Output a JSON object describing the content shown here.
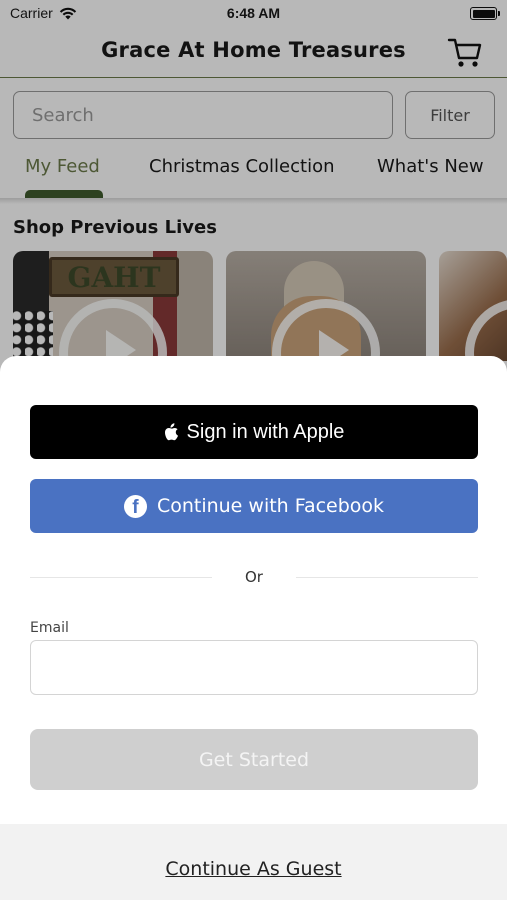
{
  "status_bar": {
    "carrier": "Carrier",
    "time": "6:48 AM"
  },
  "header": {
    "title": "Grace At Home Treasures",
    "cart_icon": "cart-icon"
  },
  "search": {
    "placeholder": "Search",
    "value": "",
    "filter_label": "Filter"
  },
  "tabs": [
    {
      "label": "My Feed",
      "active": true
    },
    {
      "label": "Christmas Collection",
      "active": false
    },
    {
      "label": "What's New",
      "active": false
    }
  ],
  "section": {
    "title": "Shop Previous Lives",
    "thumbnails": [
      {
        "sign_text": "GAHT"
      },
      {
        "sign_text": ""
      },
      {
        "sign_text": ""
      }
    ]
  },
  "sheet": {
    "apple_label": "Sign in with Apple",
    "facebook_label": "Continue with Facebook",
    "or_text": "Or",
    "email_label": "Email",
    "email_value": "",
    "get_started_label": "Get Started",
    "guest_label": "Continue As Guest"
  },
  "colors": {
    "accent_green": "#6b7a4a",
    "tab_indicator": "#3f5a2d",
    "facebook_blue": "#4a72c2",
    "apple_black": "#000000",
    "disabled_gray": "#cfcfcf"
  }
}
